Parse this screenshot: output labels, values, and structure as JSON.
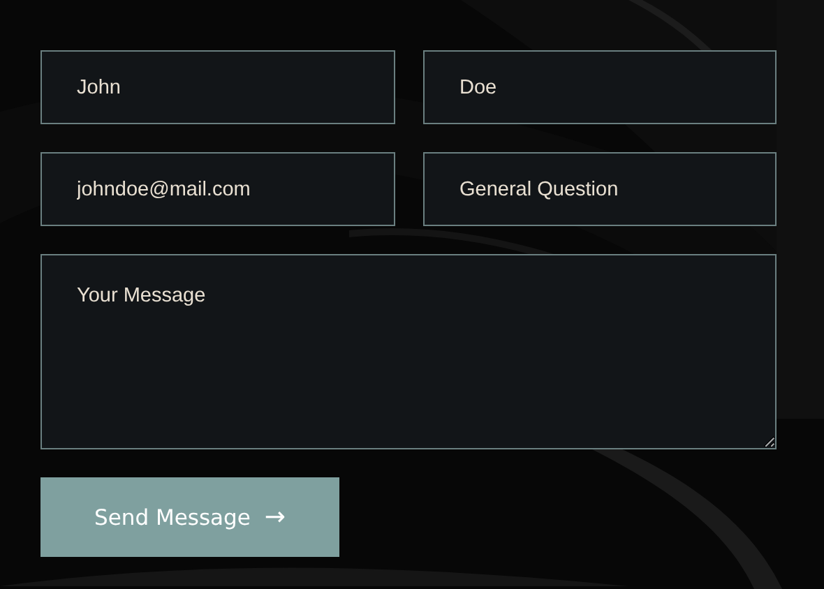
{
  "form": {
    "fields": [
      {
        "kind": "input",
        "placeholder": "John"
      },
      {
        "kind": "input",
        "placeholder": "Doe"
      },
      {
        "kind": "input",
        "placeholder": "johndoe@mail.com"
      },
      {
        "kind": "input",
        "placeholder": "General Question"
      },
      {
        "kind": "textarea",
        "placeholder": "Your Message"
      }
    ],
    "submit": {
      "label": "Send Message",
      "icon": "→"
    }
  }
}
